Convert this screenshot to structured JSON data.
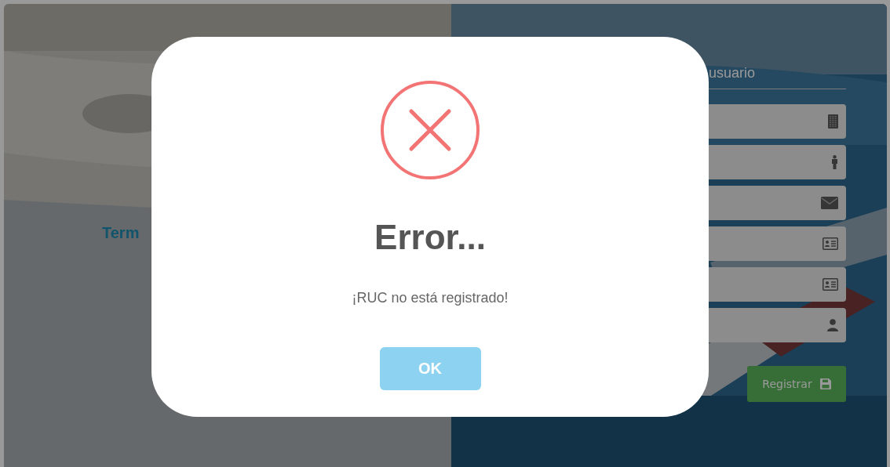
{
  "background": {
    "brand": "Term",
    "form": {
      "heading": "usuario",
      "fields": [
        {
          "kind": "company"
        },
        {
          "kind": "person"
        },
        {
          "kind": "email"
        },
        {
          "kind": "id-card"
        },
        {
          "kind": "id-card"
        },
        {
          "kind": "user"
        }
      ],
      "submit": {
        "label": "Registrar"
      }
    }
  },
  "dialog": {
    "title": "Error...",
    "message": "¡RUC no está registrado!",
    "button": "OK"
  }
}
